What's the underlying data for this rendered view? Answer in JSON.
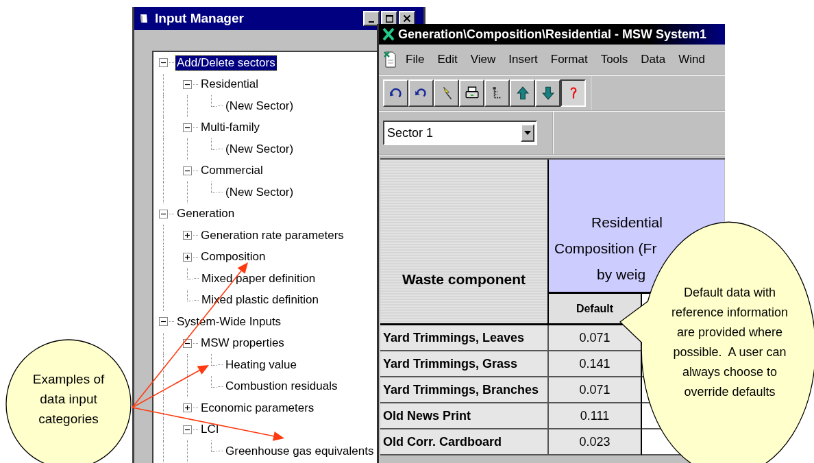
{
  "input_manager": {
    "title": "Input Manager",
    "tree": [
      {
        "label": "Add/Delete sectors",
        "kind": "folder",
        "expanded": true,
        "selected": true,
        "children": [
          {
            "label": "Residential",
            "kind": "folder",
            "expanded": true,
            "selected": false,
            "children": [
              {
                "label": "(New Sector)",
                "kind": "leaf",
                "selected": false
              }
            ]
          },
          {
            "label": "Multi-family",
            "kind": "folder",
            "expanded": true,
            "selected": false,
            "children": [
              {
                "label": "(New Sector)",
                "kind": "leaf",
                "selected": false
              }
            ]
          },
          {
            "label": "Commercial",
            "kind": "folder",
            "expanded": true,
            "selected": false,
            "children": [
              {
                "label": "(New Sector)",
                "kind": "leaf",
                "selected": false
              }
            ]
          }
        ]
      },
      {
        "label": "Generation",
        "kind": "folder",
        "expanded": true,
        "selected": false,
        "children": [
          {
            "label": "Generation rate parameters",
            "kind": "folder",
            "expanded": false,
            "selected": false
          },
          {
            "label": "Composition",
            "kind": "folder",
            "expanded": false,
            "selected": false
          },
          {
            "label": "Mixed paper definition",
            "kind": "leaf",
            "selected": false
          },
          {
            "label": "Mixed plastic definition",
            "kind": "leaf",
            "selected": false
          }
        ]
      },
      {
        "label": "System-Wide Inputs",
        "kind": "folder",
        "expanded": true,
        "selected": false,
        "children": [
          {
            "label": "MSW properties",
            "kind": "folder",
            "expanded": true,
            "selected": false,
            "children": [
              {
                "label": "Heating value",
                "kind": "leaf",
                "selected": false
              },
              {
                "label": "Combustion residuals",
                "kind": "leaf",
                "selected": false
              }
            ]
          },
          {
            "label": "Economic parameters",
            "kind": "folder",
            "expanded": false,
            "selected": false
          },
          {
            "label": "LCI",
            "kind": "folder",
            "expanded": true,
            "selected": false,
            "children": [
              {
                "label": "Greenhouse gas equivalents",
                "kind": "leaf",
                "selected": false
              }
            ]
          }
        ]
      }
    ]
  },
  "editor": {
    "title": "Generation\\Composition\\Residential - MSW System1",
    "menu": [
      "File",
      "Edit",
      "View",
      "Insert",
      "Format",
      "Tools",
      "Data",
      "Wind"
    ],
    "toolbar": [
      {
        "pressed": false
      },
      {
        "pressed": false
      },
      {
        "pressed": false
      },
      {
        "pressed": false
      },
      {
        "pressed": false
      },
      {
        "pressed": false
      },
      {
        "pressed": false
      },
      {
        "pressed": true
      }
    ],
    "sector_select": {
      "value": "Sector 1"
    },
    "table": {
      "component_header": "Waste component",
      "composition_header_lines": [
        "Residential",
        "Composition (Fr",
        "by weig"
      ],
      "subheader": "Default",
      "rows": [
        {
          "component": "Yard Trimmings, Leaves",
          "default": "0.071"
        },
        {
          "component": "Yard Trimmings, Grass",
          "default": "0.141"
        },
        {
          "component": "Yard Trimmings, Branches",
          "default": "0.071"
        },
        {
          "component": "Old News Print",
          "default": "0.111"
        },
        {
          "component": "Old Corr. Cardboard",
          "default": "0.023"
        }
      ]
    }
  },
  "callouts": [
    {
      "text": "Examples of data input categories"
    },
    {
      "text": "Default data with reference information are provided where possible.  A user can always choose to override defaults"
    }
  ]
}
